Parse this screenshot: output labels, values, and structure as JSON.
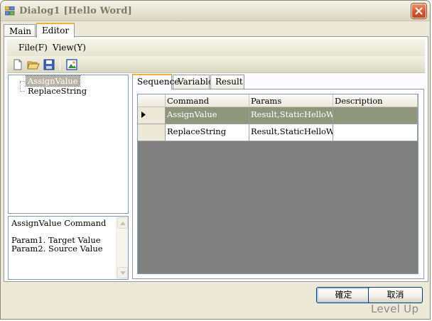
{
  "window": {
    "title": "Dialog1 [Hello Word]"
  },
  "main_tabs": [
    {
      "label": "Main",
      "active": false
    },
    {
      "label": "Editor",
      "active": true
    }
  ],
  "menu": {
    "items": [
      {
        "label": "File(F)"
      },
      {
        "label": "View(Y)"
      }
    ]
  },
  "toolbar": {
    "icons": [
      "new-file-icon",
      "open-folder-icon",
      "save-icon",
      "image-icon"
    ]
  },
  "tree": {
    "nodes": [
      {
        "label": "AssignValue",
        "selected": true
      },
      {
        "label": "ReplaceString",
        "selected": false
      }
    ]
  },
  "description": {
    "text": "AssignValue Command\n\nParam1. Target Value\nParam2. Source Value"
  },
  "inner_tabs": [
    {
      "label": "Sequence",
      "active": true
    },
    {
      "label": "Variable",
      "active": false
    },
    {
      "label": "Result",
      "active": false
    }
  ],
  "grid": {
    "columns": [
      "Command",
      "Params",
      "Description"
    ],
    "rows": [
      {
        "command": "AssignValue",
        "params": "Result,StaticHelloWorld",
        "description": "",
        "selected": true
      },
      {
        "command": "ReplaceString",
        "params": "Result,StaticHelloWor...",
        "description": "",
        "selected": false
      }
    ]
  },
  "buttons": {
    "ok": "確定",
    "cancel": "取消"
  },
  "watermark": "Level Up",
  "colors": {
    "selected_row": "#8e977b",
    "grid_background": "#808080",
    "accent_tab": "#f5b336",
    "close_button": "#d4582f"
  }
}
